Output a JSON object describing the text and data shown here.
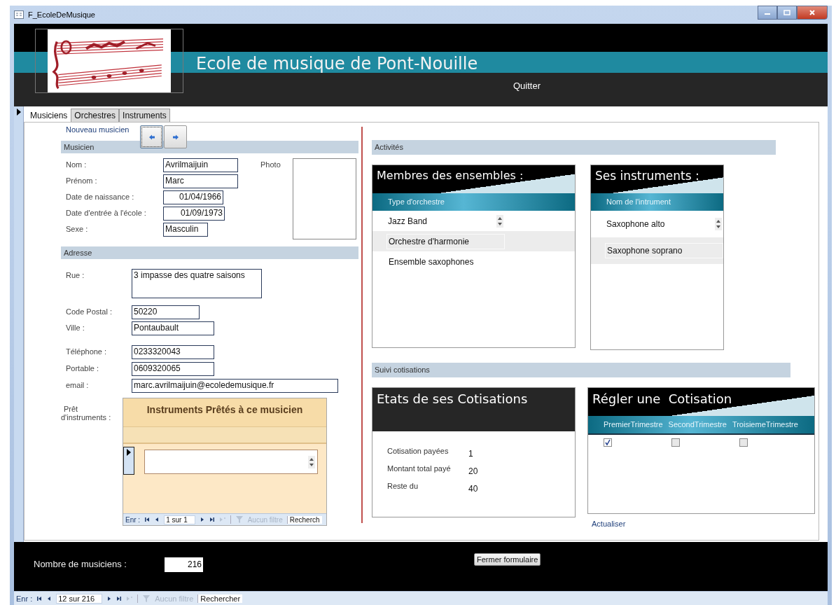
{
  "window": {
    "title": "F_EcoleDeMusique"
  },
  "header": {
    "title": "Ecole de musique de Pont-Nouille",
    "quit_link": "Quitter"
  },
  "tabs": [
    {
      "label": "Musiciens",
      "selected": true
    },
    {
      "label": "Orchestres",
      "selected": false
    },
    {
      "label": "Instruments",
      "selected": false
    }
  ],
  "new_musician_link": "Nouveau musicien",
  "musician_section": {
    "title": "Musicien",
    "photo_label": "Photo",
    "fields": [
      {
        "label": "Nom :",
        "value": "Avrilmaijuin",
        "kind": "text"
      },
      {
        "label": "Prénom :",
        "value": "Marc",
        "kind": "text"
      },
      {
        "label": "Date de naissance :",
        "value": "01/04/1966",
        "kind": "date"
      },
      {
        "label": "Date d'entrée à l'école :",
        "value": "01/09/1973",
        "kind": "date"
      },
      {
        "label": "Sexe :",
        "value": "Masculin",
        "kind": "text"
      }
    ]
  },
  "address_section": {
    "title": "Adresse",
    "fields": [
      {
        "label": "Rue :",
        "value": "3 impasse des quatre saisons",
        "kind": "multiline"
      },
      {
        "label": "Code Postal :",
        "value": "50220",
        "kind": "text"
      },
      {
        "label": "Ville :",
        "value": "Pontaubault",
        "kind": "text"
      },
      {
        "label": "Téléphone :",
        "value": "0233320043",
        "kind": "text"
      },
      {
        "label": "Portable :",
        "value": "0609320065",
        "kind": "text"
      },
      {
        "label": "email :",
        "value": "marc.avrilmaijuin@ecoledemusique.fr",
        "kind": "text"
      }
    ]
  },
  "loans": {
    "label_lines": [
      "Prêt",
      "d'instruments :"
    ],
    "subform_title": "Instruments Prêtés à ce musicien",
    "nav": {
      "prefix": "Enr :",
      "position": "1 sur 1",
      "filter": "Aucun filtre",
      "search": "Recherch"
    }
  },
  "activities": {
    "title": "Activités",
    "ensembles": {
      "title": "Membres des ensembles :",
      "column": "Type d'orchestre",
      "rows": [
        {
          "value": "Jazz Band",
          "selected": true
        },
        {
          "value": "Orchestre d'harmonie",
          "selected": false
        },
        {
          "value": "Ensemble saxophones",
          "selected": false
        }
      ]
    },
    "instruments": {
      "title": "Ses instruments :",
      "column": "Nom de l'intrument",
      "rows": [
        {
          "value": "Saxophone alto",
          "selected": true
        },
        {
          "value": "Saxophone soprano",
          "selected": false
        }
      ]
    }
  },
  "dues": {
    "title": "Suivi cotisations",
    "status": {
      "title": "Etats de ses Cotisations",
      "rows": [
        {
          "label": "Cotisation payées",
          "value": "1"
        },
        {
          "label": "Montant total payé",
          "value": "20"
        },
        {
          "label": "Reste du",
          "value": "40"
        }
      ]
    },
    "pay": {
      "title": "Régler une  Cotisation",
      "columns": [
        {
          "label": "PremierTrimestre",
          "checked": true
        },
        {
          "label": "SecondTrimestre",
          "checked": false
        },
        {
          "label": "TroisiemeTrimestre",
          "checked": false
        }
      ]
    },
    "refresh_link": "Actualiser"
  },
  "footer": {
    "count_label": "Nombre de musiciens :",
    "count": "216",
    "close_button": "Fermer formulaire"
  },
  "status_bar": {
    "prefix": "Enr :",
    "position": "12 sur 216",
    "filter": "Aucun filtre",
    "search": "Rechercher"
  }
}
